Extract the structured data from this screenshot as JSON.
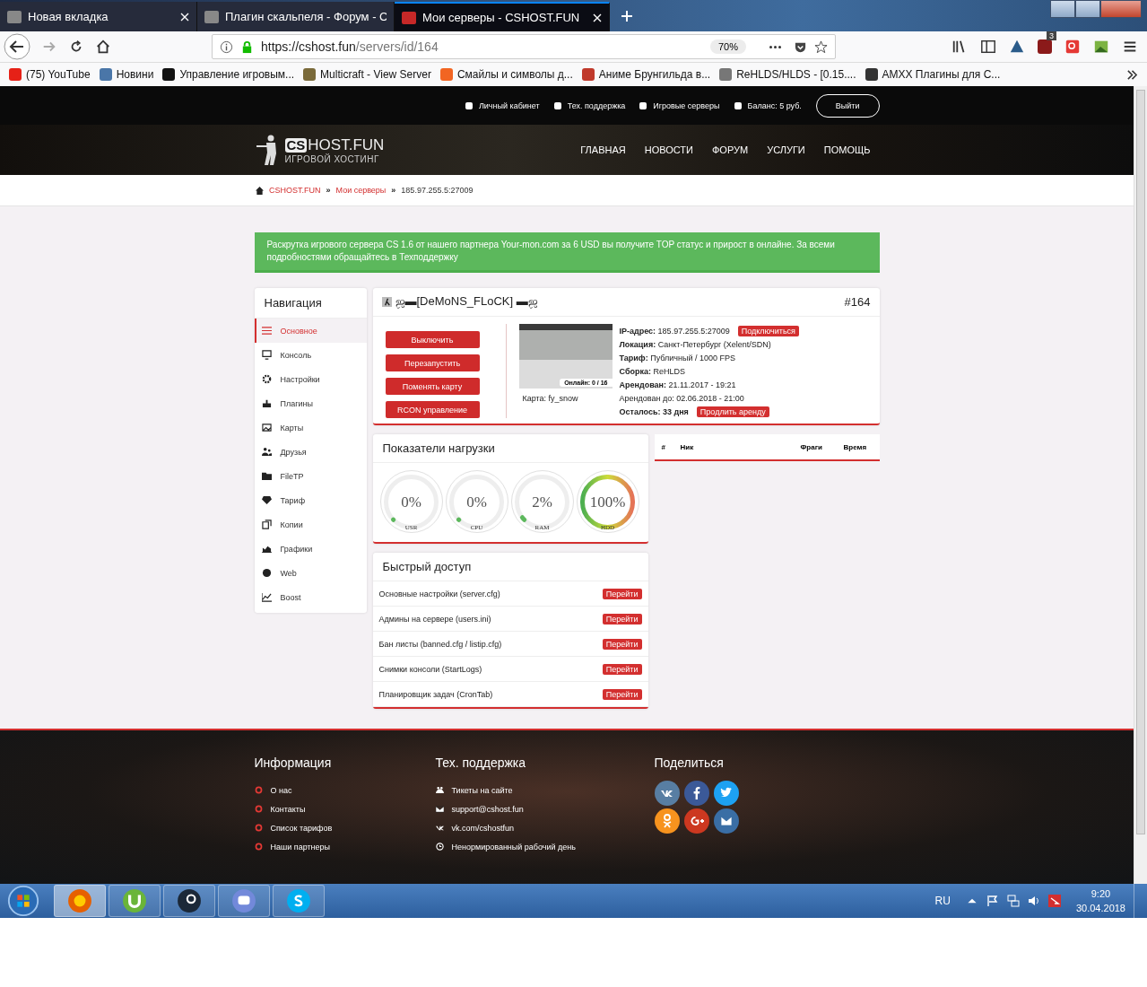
{
  "browser": {
    "tabs": [
      {
        "title": "Новая вкладка",
        "selected": false
      },
      {
        "title": "Плагин скальпеля - Форум - C",
        "selected": false
      },
      {
        "title": "Мои серверы - CSHOST.FUN",
        "selected": true
      }
    ],
    "url_host": "https://cshost.fun",
    "url_path": "/servers/id/164",
    "zoom": "70%",
    "addon_badge": "3",
    "bookmarks": [
      "(75) YouTube",
      "Новини",
      "Управление игровым...",
      "Multicraft - View Server",
      "Смайлы и символы д...",
      "Аниме Брунгильда в...",
      "ReHLDS/HLDS - [0.15....",
      "AMXX Плагины для C..."
    ]
  },
  "site": {
    "top_links": [
      "Личный кабинет",
      "Тех. поддержка",
      "Игровые серверы",
      "Баланс: 5 руб."
    ],
    "logout": "Выйти",
    "logo": {
      "mark": "CS",
      "name": "HOST.FUN",
      "tagline": "ИГРОВОЙ ХОСТИНГ"
    },
    "menu": [
      "ГЛАВНАЯ",
      "НОВОСТИ",
      "ФОРУМ",
      "УСЛУГИ",
      "ПОМОЩЬ"
    ],
    "breadcrumb": [
      {
        "label": "CSHOST.FUN",
        "link": true
      },
      {
        "separator": "»",
        "label": "Мои серверы",
        "link": true
      },
      {
        "separator": "»",
        "label": "185.97.255.5:27009",
        "link": false
      }
    ],
    "promo": "Раскрутка игрового сервера CS 1.6 от нашего партнера Your-mon.com за 6 USD вы получите TOP статус и прирост в онлайне. За всеми подробностями обращайтесь в Техподдержку",
    "nav": {
      "title": "Навигация",
      "items": [
        {
          "label": "Основное",
          "selected": true
        },
        {
          "label": "Консоль",
          "selected": false
        },
        {
          "label": "Настройки",
          "selected": false
        },
        {
          "label": "Плагины",
          "selected": false
        },
        {
          "label": "Карты",
          "selected": false
        },
        {
          "label": "Друзья",
          "selected": false
        },
        {
          "label": "FileTP",
          "selected": false
        },
        {
          "label": "Тариф",
          "selected": false
        },
        {
          "label": "Копии",
          "selected": false
        },
        {
          "label": "Графики",
          "selected": false
        },
        {
          "label": "Web",
          "selected": false
        },
        {
          "label": "Boost",
          "selected": false
        }
      ]
    },
    "server": {
      "name": "ஜ▬[DeMoNS_FLoCK] ▬ஜ",
      "id": "#164",
      "actions": [
        "Выключить",
        "Перезапустить",
        "Поменять карту",
        "RCON управление"
      ],
      "online": "Онлайн: 0 / 16",
      "map": "Карта: fy_snow",
      "details": [
        {
          "text": "**IP-адрес:** 185.97.255.5:27009",
          "action": "Подключиться"
        },
        {
          "text": "**Локация:** Санкт-Петербург (Xelent/SDN)"
        },
        {
          "text": "**Тариф:** Публичный / 1000 FPS"
        },
        {
          "text": "**Сборка:** ReHLDS"
        },
        {
          "text": "**Арендован:** 21.11.2017 - 19:21"
        },
        {
          "text": "Арендован до: 02.06.2018 - 21:00"
        },
        {
          "text": "**Осталось: 33 дня**",
          "action": "Продлить аренду"
        }
      ]
    },
    "load": {
      "title": "Показатели нагрузки",
      "gauges": [
        {
          "value": "0%",
          "label": "USR"
        },
        {
          "value": "0%",
          "label": "CPU"
        },
        {
          "value": "2%",
          "label": "RAM"
        },
        {
          "value": "100%",
          "label": "HDD"
        }
      ]
    },
    "players": {
      "columns": [
        "#",
        "Ник",
        "Фраги",
        "Время"
      ]
    },
    "quick": {
      "title": "Быстрый доступ",
      "items": [
        {
          "label": "Основные настройки (server.cfg)",
          "action": "Перейти"
        },
        {
          "label": "Админы на сервере (users.ini)",
          "action": "Перейти"
        },
        {
          "label": "Бан листы (banned.cfg / listip.cfg)",
          "action": "Перейти"
        },
        {
          "label": "Снимки консоли (StartLogs)",
          "action": "Перейти"
        },
        {
          "label": "Планировщик задач (CronTab)",
          "action": "Перейти"
        }
      ]
    },
    "footer": {
      "info": {
        "title": "Информация",
        "links": [
          "О нас",
          "Контакты",
          "Список тарифов",
          "Наши партнеры"
        ]
      },
      "support": {
        "title": "Тех. поддержка",
        "items": [
          "Тикеты на сайте",
          "support@cshost.fun",
          "vk.com/cshostfun",
          "Ненормированный рабочий день"
        ]
      },
      "share": {
        "title": "Поделиться",
        "buttons": [
          {
            "color": "#587ea3"
          },
          {
            "color": "#3b5998"
          },
          {
            "color": "#1da1f2"
          },
          {
            "color": "#f7931e"
          },
          {
            "color": "#cc3820"
          },
          {
            "color": "#3a6ea5"
          }
        ]
      }
    }
  },
  "taskbar": {
    "apps": [
      {
        "active": true
      },
      {
        "active": false
      },
      {
        "active": false
      },
      {
        "active": false
      },
      {
        "active": false
      }
    ],
    "lang": "RU",
    "time": "9:20",
    "date": "30.04.2018"
  }
}
